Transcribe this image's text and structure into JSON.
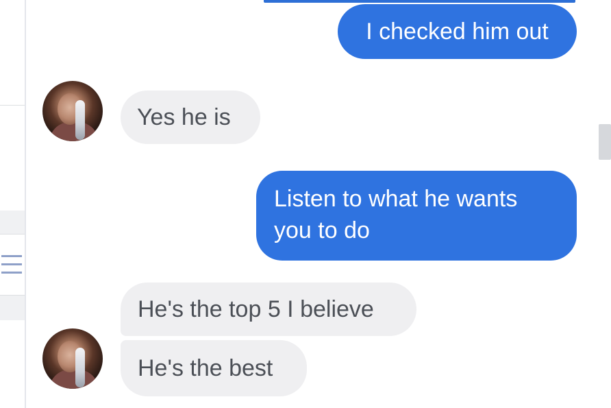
{
  "conversation": {
    "messages": [
      {
        "direction": "outgoing",
        "text": "I checked him out"
      },
      {
        "direction": "incoming",
        "text": "Yes he is"
      },
      {
        "direction": "outgoing",
        "text": "Listen to what he wants you to do"
      },
      {
        "direction": "incoming",
        "text": "He's the top 5 I believe"
      },
      {
        "direction": "incoming",
        "text": "He's the best"
      }
    ]
  },
  "icons": {
    "menu": "menu-icon",
    "avatar": "contact-avatar"
  },
  "colors": {
    "outgoing_bubble": "#2f73e0",
    "incoming_bubble": "#efeff1",
    "incoming_text": "#4b4f56",
    "outgoing_text": "#ffffff"
  }
}
